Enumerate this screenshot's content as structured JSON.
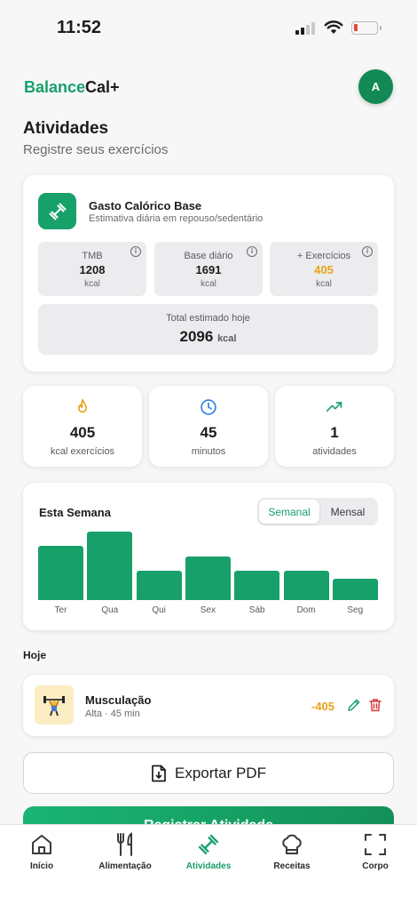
{
  "status_bar": {
    "time": "11:52"
  },
  "header": {
    "brand_part1": "Balance",
    "brand_part2": "Cal+",
    "avatar_initial": "A"
  },
  "page": {
    "title": "Atividades",
    "subtitle": "Registre seus exercícios"
  },
  "base_card": {
    "title": "Gasto Calórico Base",
    "subtitle": "Estimativa diária em repouso/sedentário",
    "tmb": {
      "label": "TMB",
      "value": "1208",
      "unit": "kcal"
    },
    "base_daily": {
      "label": "Base diário",
      "value": "1691",
      "unit": "kcal"
    },
    "exercises": {
      "label": "+ Exercícios",
      "value": "405",
      "unit": "kcal",
      "color": "#e8a318"
    },
    "total": {
      "label": "Total estimado hoje",
      "value": "2096",
      "unit": "kcal"
    }
  },
  "stats": [
    {
      "icon": "flame-icon",
      "value": "405",
      "label": "kcal exercícios",
      "color": "#e8a318"
    },
    {
      "icon": "clock-icon",
      "value": "45",
      "label": "minutos",
      "color": "#2f7fe0"
    },
    {
      "icon": "trending-up-icon",
      "value": "1",
      "label": "atividades",
      "color": "#17a06a"
    }
  ],
  "week": {
    "title": "Esta Semana",
    "toggle": {
      "active": "Semanal",
      "inactive": "Mensal"
    },
    "chart_data": {
      "type": "bar",
      "categories": [
        "Ter",
        "Qua",
        "Qui",
        "Sex",
        "Sáb",
        "Dom",
        "Seg"
      ],
      "values": [
        0.79,
        1.0,
        0.43,
        0.64,
        0.43,
        0.43,
        0.31
      ]
    }
  },
  "today": {
    "heading": "Hoje",
    "activity": {
      "name": "Musculação",
      "meta": "Alta · 45 min",
      "kcal": "-405"
    }
  },
  "export_button": "Exportar PDF",
  "register_button": "Registrar Atividade",
  "nav": [
    {
      "label": "Início",
      "icon": "home-icon"
    },
    {
      "label": "Alimentação",
      "icon": "utensils-icon"
    },
    {
      "label": "Atividades",
      "icon": "dumbbell-icon",
      "active": true
    },
    {
      "label": "Receitas",
      "icon": "chef-hat-icon"
    },
    {
      "label": "Corpo",
      "icon": "scan-body-icon"
    }
  ],
  "colors": {
    "accent": "#17a06a",
    "orange": "#e8a318"
  }
}
